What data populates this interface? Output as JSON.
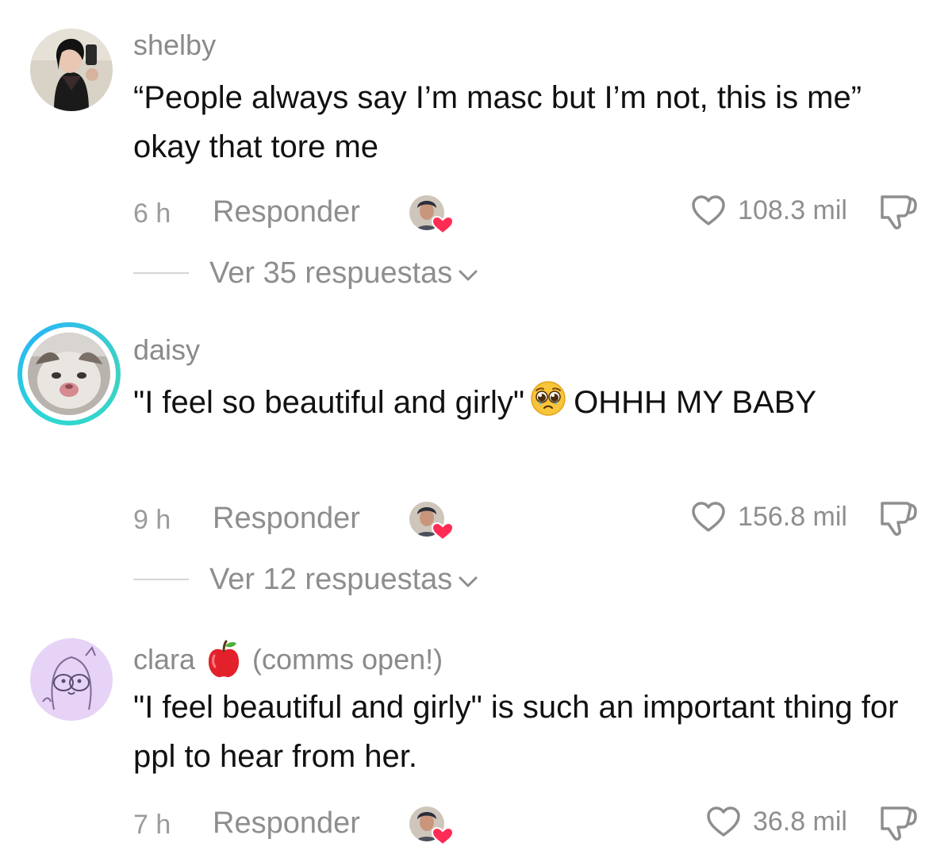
{
  "comments": [
    {
      "username": "shelby",
      "text": "“People always say I’m masc but I’m not, this is me” okay that tore me",
      "time": "6 h",
      "reply_label": "Responder",
      "likes": "108.3 mil",
      "replies_label": "Ver 35 respuestas"
    },
    {
      "username": "daisy",
      "text_before_emoji": "\"I feel so beautiful and girly\"",
      "text_after_emoji": "OHHH MY BABY",
      "emoji": "pleading-face",
      "time": "9 h",
      "reply_label": "Responder",
      "likes": "156.8 mil",
      "replies_label": "Ver 12 respuestas",
      "has_story_ring": true
    },
    {
      "username": "clara",
      "username_emoji": "red-apple",
      "username_suffix": "(comms open!)",
      "text": "\"I feel beautiful and girly\" is such an important thing for ppl to hear from her.",
      "time": "7 h",
      "reply_label": "Responder",
      "likes": "36.8 mil"
    }
  ],
  "colors": {
    "secondary_text": "#8e8e8e",
    "creator_heart": "#fe2c55",
    "story_ring": "#2fd7d0"
  },
  "icons": {
    "like": "heart-outline-icon",
    "dislike": "thumbs-down-icon",
    "creator_liked": "creator-liked-badge",
    "expand": "chevron-down-icon"
  }
}
